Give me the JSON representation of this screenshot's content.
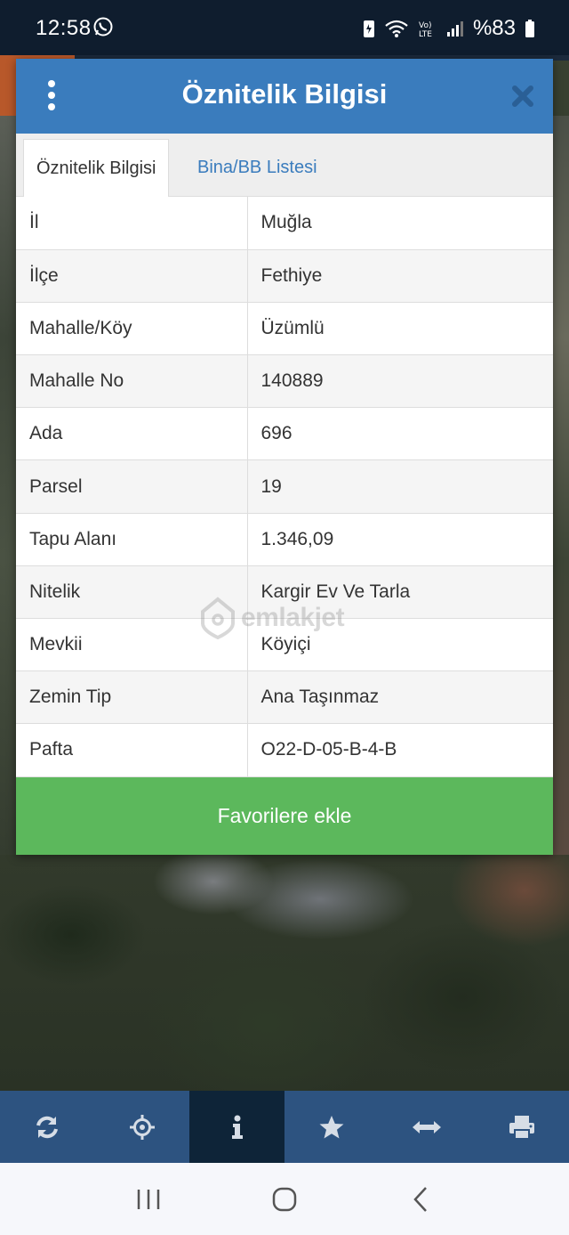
{
  "status_bar": {
    "time": "12:58",
    "battery": "%83"
  },
  "dialog": {
    "title": "Öznitelik Bilgisi",
    "tabs": [
      {
        "label": "Öznitelik Bilgisi",
        "active": true
      },
      {
        "label": "Bina/BB Listesi",
        "active": false
      }
    ],
    "rows": [
      {
        "key": "İl",
        "value": "Muğla"
      },
      {
        "key": "İlçe",
        "value": "Fethiye"
      },
      {
        "key": "Mahalle/Köy",
        "value": "Üzümlü"
      },
      {
        "key": "Mahalle No",
        "value": "140889"
      },
      {
        "key": "Ada",
        "value": "696"
      },
      {
        "key": "Parsel",
        "value": "19"
      },
      {
        "key": "Tapu Alanı",
        "value": "1.346,09"
      },
      {
        "key": "Nitelik",
        "value": "Kargir Ev Ve Tarla"
      },
      {
        "key": "Mevkii",
        "value": "Köyiçi"
      },
      {
        "key": "Zemin Tip",
        "value": "Ana Taşınmaz"
      },
      {
        "key": "Pafta",
        "value": "O22-D-05-B-4-B"
      }
    ],
    "favorite_button": "Favorilere ekle",
    "watermark": "emlakjet"
  },
  "toolbar": {
    "items": [
      {
        "icon": "refresh-icon",
        "active": false
      },
      {
        "icon": "crosshair-icon",
        "active": false
      },
      {
        "icon": "info-icon",
        "active": true
      },
      {
        "icon": "star-icon",
        "active": false
      },
      {
        "icon": "measure-arrows-icon",
        "active": false
      },
      {
        "icon": "print-icon",
        "active": false
      }
    ]
  },
  "colors": {
    "header": "#3a7cbd",
    "favorite_button": "#5cb85c",
    "toolbar": "#2d5380",
    "toolbar_active": "#0e2438",
    "status_bar": "#0f1d2e"
  }
}
